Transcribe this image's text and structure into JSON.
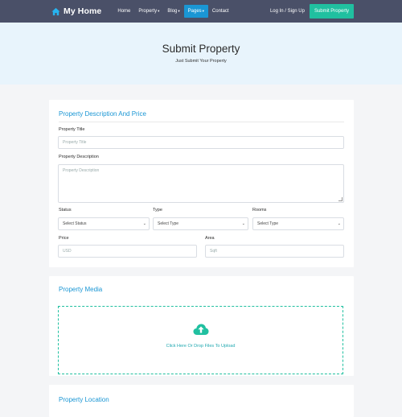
{
  "nav": {
    "brand": "My Home",
    "links": [
      {
        "label": "Home"
      },
      {
        "label": "Property"
      },
      {
        "label": "Blog"
      },
      {
        "label": "Pages"
      },
      {
        "label": "Contact"
      }
    ],
    "active_link": "Pages",
    "login": "Log In / Sign Up",
    "submit": "Submit Property"
  },
  "hero": {
    "title": "Submit Property",
    "subtitle": "Just Submit Your Property"
  },
  "description_card": {
    "title": "Property Description And Price",
    "title_label": "Property Title",
    "title_placeholder": "Property Title",
    "desc_label": "Property Description",
    "desc_placeholder": "Property Description",
    "status_label": "Status",
    "status_value": "Select Status",
    "type_label": "Type",
    "type_value": "Select Type",
    "rooms_label": "Rooms",
    "rooms_value": "Select Type",
    "price_label": "Price",
    "price_placeholder": "USD",
    "area_label": "Area",
    "area_placeholder": "Sqft"
  },
  "media_card": {
    "title": "Property Media",
    "drop_text": "Click Here Or Drop Files To Upload"
  },
  "location_card": {
    "title": "Property Location"
  },
  "colors": {
    "nav_bg": "#4a5068",
    "accent_blue": "#1a96d4",
    "accent_green": "#20c0a0",
    "hero_bg": "#e8f4fc"
  },
  "icons": {
    "brand": "house-icon",
    "upload": "cloud-upload-icon"
  }
}
